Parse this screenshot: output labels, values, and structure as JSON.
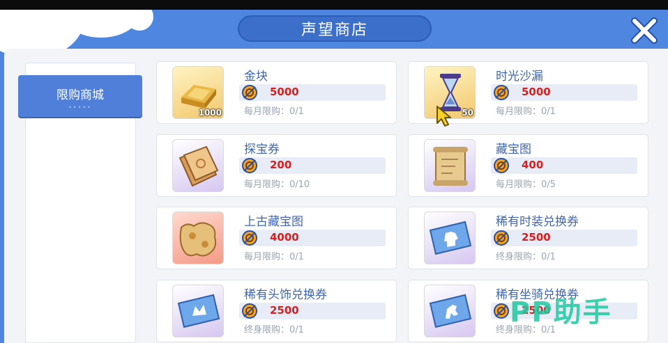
{
  "title": "声望商店",
  "sidebar": {
    "tabs": [
      {
        "label": "限购商城",
        "dots": "•••••"
      }
    ]
  },
  "currency_icon": "reputation-coin-icon",
  "colors": {
    "frame": "#4f86e0",
    "price": "#d81e1e",
    "name": "#3f65b0",
    "watermark": "#1ec9a0"
  },
  "items": [
    {
      "name": "金块",
      "price": "5000",
      "limit": "每月限购：0/1",
      "qty": "1000",
      "icon": "gold-bar-icon"
    },
    {
      "name": "时光沙漏",
      "price": "5000",
      "limit": "每月限购：0/1",
      "qty": "50",
      "icon": "hourglass-icon"
    },
    {
      "name": "探宝券",
      "price": "200",
      "limit": "每月限购：0/10",
      "qty": "",
      "icon": "treasure-ticket-icon"
    },
    {
      "name": "藏宝图",
      "price": "400",
      "limit": "每月限购：0/5",
      "qty": "",
      "icon": "treasure-map-icon"
    },
    {
      "name": "上古藏宝图",
      "price": "4000",
      "limit": "每月限购：0/1",
      "qty": "",
      "icon": "ancient-treasure-map-icon"
    },
    {
      "name": "稀有时装兑换券",
      "price": "2500",
      "limit": "终身限购：0/1",
      "qty": "",
      "icon": "fashion-coupon-icon"
    },
    {
      "name": "稀有头饰兑换券",
      "price": "2500",
      "limit": "终身限购：0/1",
      "qty": "",
      "icon": "headwear-coupon-icon"
    },
    {
      "name": "稀有坐骑兑换券",
      "price": "2500",
      "limit": "终身限购：0/1",
      "qty": "",
      "icon": "mount-coupon-icon"
    }
  ],
  "watermark": "PP助手"
}
